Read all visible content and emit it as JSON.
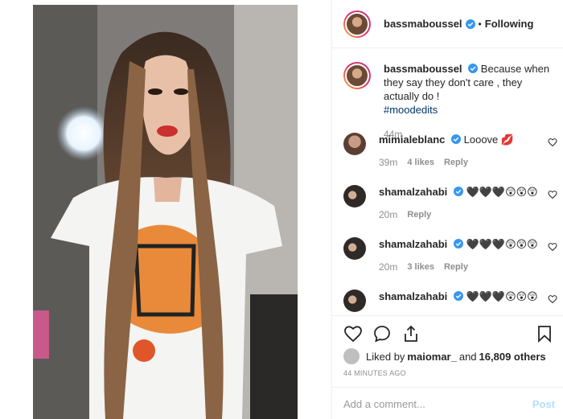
{
  "post": {
    "username": "bassmaboussel",
    "follow_state": "Following",
    "caption_text": "Because when they say they don't care , they actually do !",
    "hashtag": "#moodedits",
    "caption_time": "44m"
  },
  "comments": [
    {
      "username": "mimialeblanc",
      "text": "Looove 💋",
      "time": "39m",
      "likes": "4 likes",
      "reply": "Reply"
    },
    {
      "username": "shamalzahabi",
      "text": "🖤🖤🖤😲😲😲",
      "time": "20m",
      "likes": "",
      "reply": "Reply"
    },
    {
      "username": "shamalzahabi",
      "text": "🖤🖤🖤😲😲😲",
      "time": "20m",
      "likes": "3 likes",
      "reply": "Reply"
    },
    {
      "username": "shamalzahabi",
      "text": "🖤🖤🖤😲😲😲",
      "time": "",
      "likes": "",
      "reply": ""
    }
  ],
  "likes": {
    "prefix": "Liked by ",
    "user": "maiomar_",
    "middle": " and ",
    "count": "16,809 others"
  },
  "timestamp": "44 MINUTES AGO",
  "add_comment": {
    "placeholder": "Add a comment...",
    "post_label": "Post"
  },
  "colors": {
    "verified": "#3897f0",
    "link": "#003569",
    "muted": "#8e8e8e"
  }
}
